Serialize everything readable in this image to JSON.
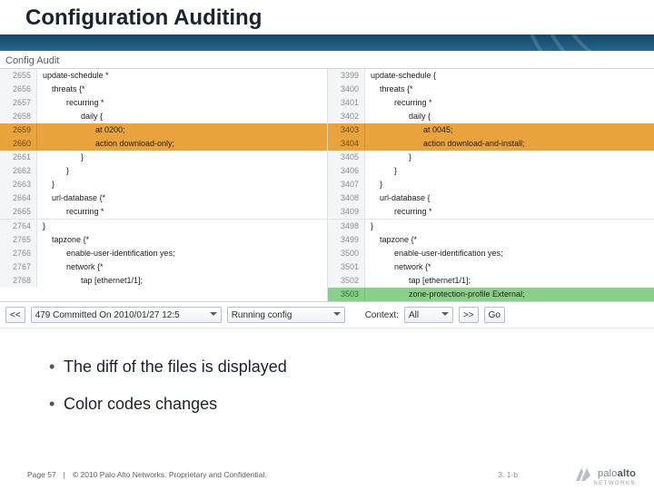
{
  "title": "Configuration Auditing",
  "panel_label": "Config Audit",
  "left": {
    "block1": [
      {
        "ln": "2655",
        "txt": "update-schedule *",
        "ind": 0
      },
      {
        "ln": "2656",
        "txt": "threats {*",
        "ind": 1
      },
      {
        "ln": "2657",
        "txt": "recurring *",
        "ind": 2
      },
      {
        "ln": "2658",
        "txt": "daily {",
        "ind": 3
      },
      {
        "ln": "2659",
        "txt": "at 0200;",
        "ind": 4,
        "hl": "orange"
      },
      {
        "ln": "2660",
        "txt": "action download-only;",
        "ind": 4,
        "hl": "orange"
      },
      {
        "ln": "2661",
        "txt": "}",
        "ind": 3
      },
      {
        "ln": "2662",
        "txt": "}",
        "ind": 2
      },
      {
        "ln": "2663",
        "txt": "}",
        "ind": 1
      },
      {
        "ln": "2664",
        "txt": "url-database {*",
        "ind": 1
      },
      {
        "ln": "2665",
        "txt": "recurring *",
        "ind": 2
      }
    ],
    "block2": [
      {
        "ln": "2764",
        "txt": "}",
        "ind": 0
      },
      {
        "ln": "2765",
        "txt": "tapzone {*",
        "ind": 1
      },
      {
        "ln": "2766",
        "txt": "enable-user-identification yes;",
        "ind": 2
      },
      {
        "ln": "2767",
        "txt": "network {*",
        "ind": 2
      },
      {
        "ln": "2768",
        "txt": "tap [ethernet1/1];",
        "ind": 3
      }
    ]
  },
  "right": {
    "block1": [
      {
        "ln": "3399",
        "txt": "update-schedule {",
        "ind": 0
      },
      {
        "ln": "3400",
        "txt": "threats {*",
        "ind": 1
      },
      {
        "ln": "3401",
        "txt": "recurring *",
        "ind": 2
      },
      {
        "ln": "3402",
        "txt": "daily {",
        "ind": 3
      },
      {
        "ln": "3403",
        "txt": "at 0045;",
        "ind": 4,
        "hl": "orange"
      },
      {
        "ln": "3404",
        "txt": "action download-and-install;",
        "ind": 4,
        "hl": "orange"
      },
      {
        "ln": "3405",
        "txt": "}",
        "ind": 3
      },
      {
        "ln": "3406",
        "txt": "}",
        "ind": 2
      },
      {
        "ln": "3407",
        "txt": "}",
        "ind": 1
      },
      {
        "ln": "3408",
        "txt": "url-database {",
        "ind": 1
      },
      {
        "ln": "3409",
        "txt": "recurring *",
        "ind": 2
      }
    ],
    "block2": [
      {
        "ln": "3498",
        "txt": "}",
        "ind": 0
      },
      {
        "ln": "3499",
        "txt": "tapzone {*",
        "ind": 1
      },
      {
        "ln": "3500",
        "txt": "enable-user-identification yes;",
        "ind": 2
      },
      {
        "ln": "3501",
        "txt": "network {*",
        "ind": 2
      },
      {
        "ln": "3502",
        "txt": "tap [ethernet1/1];",
        "ind": 3
      },
      {
        "ln": "3503",
        "txt": "zone-protection-profile External;",
        "ind": 3,
        "hl": "green"
      }
    ]
  },
  "toolbar": {
    "prev": "<<",
    "left_select": "479 Committed On 2010/01/27 12:5",
    "right_select": "Running config",
    "context_label": "Context:",
    "context_value": "All",
    "next": ">>",
    "go": "Go"
  },
  "bullets": {
    "b1": "The diff of the files is displayed",
    "b2": "Color codes changes"
  },
  "footer": {
    "page": "Page 57",
    "copyright": "© 2010 Palo Alto Networks. Proprietary and Confidential.",
    "version": "3. 1-b"
  },
  "logo": {
    "brand_light": "palo",
    "brand_bold": "alto",
    "sub": "NETWORKS"
  }
}
